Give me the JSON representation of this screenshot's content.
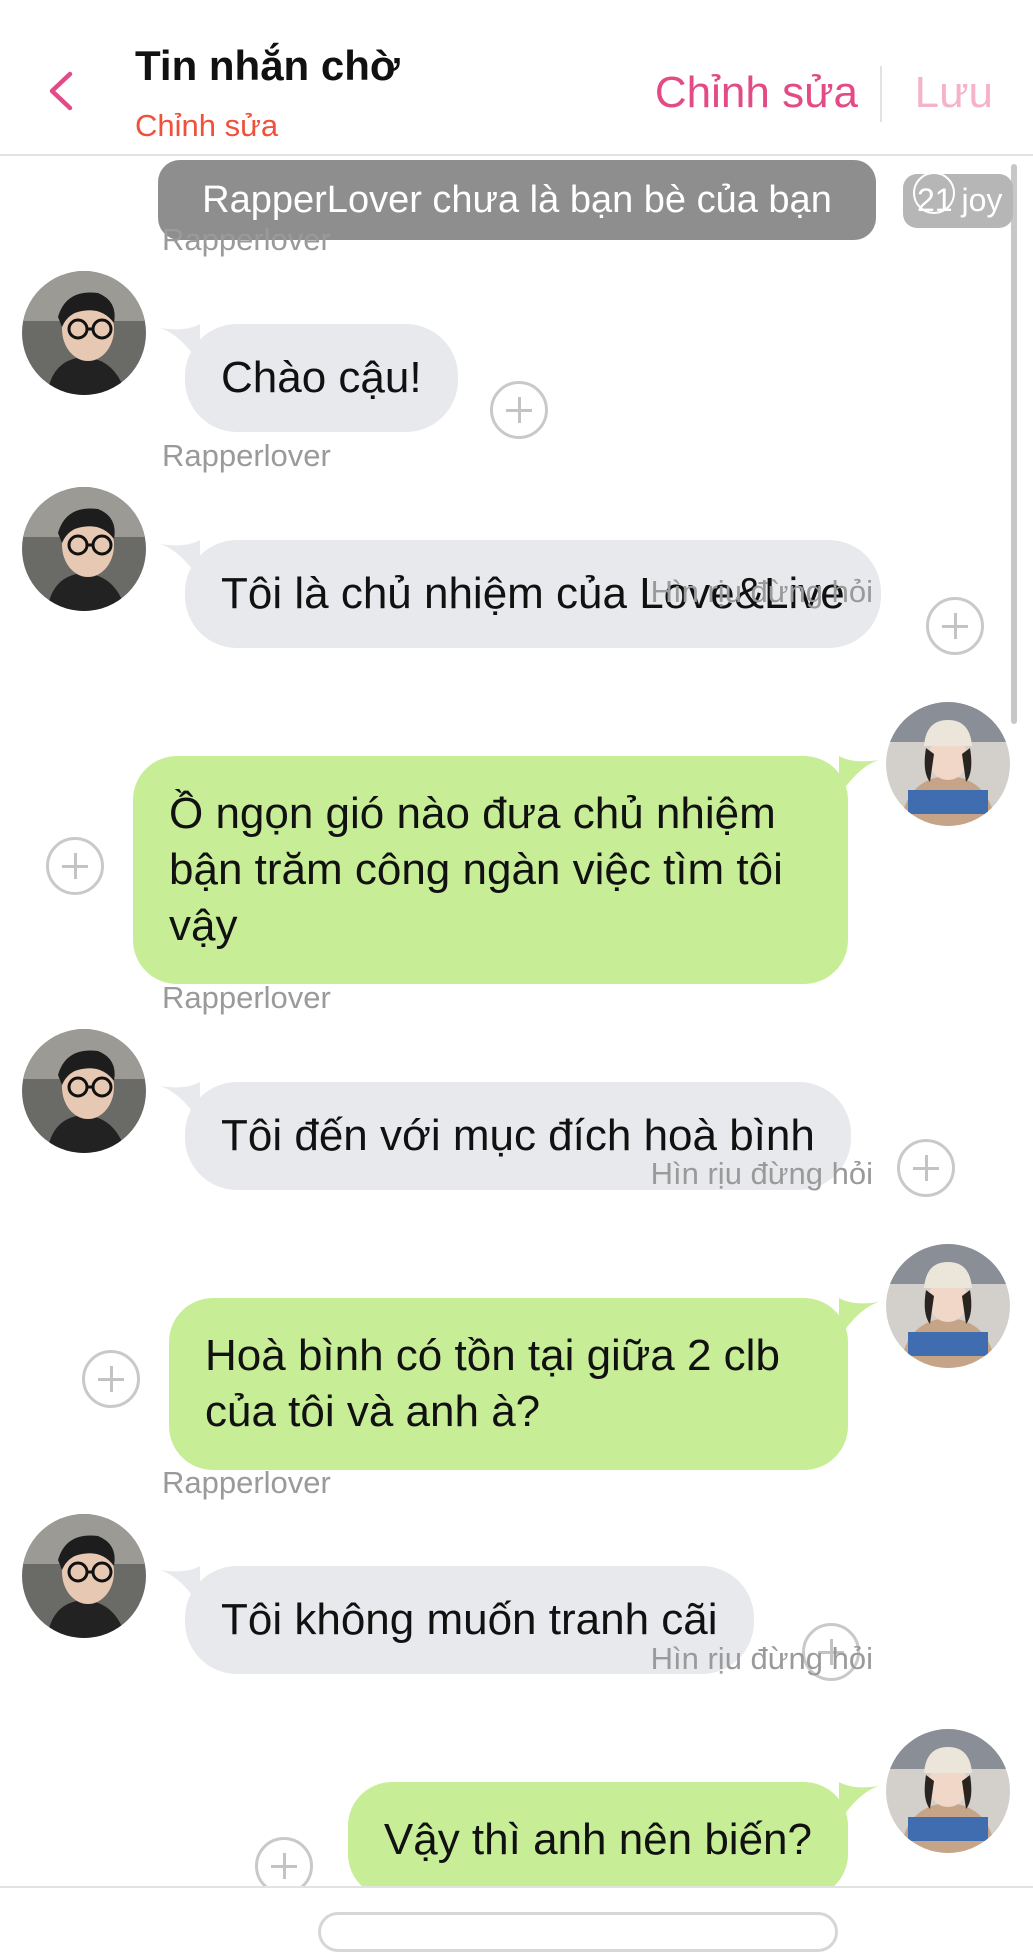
{
  "header": {
    "title": "Tin nhắn chờ",
    "subtitle": "Chỉnh sửa",
    "edit_label": "Chỉnh sửa",
    "save_label": "Lưu"
  },
  "notice": {
    "text": "RapperLover chưa là bạn bè của bạn",
    "badge": "21 joy"
  },
  "messages": [
    {
      "sender": "Rapperlover",
      "text": "Chào cậu!",
      "direction": "incoming"
    },
    {
      "sender": "Rapperlover",
      "text": "Tôi là chủ nhiệm của Love&Live",
      "direction": "incoming"
    },
    {
      "sender": "Hìn rịu đừng hỏi",
      "text": "Ồ ngọn gió nào đưa chủ nhiệm bận trăm công ngàn việc tìm tôi vậy",
      "direction": "outgoing"
    },
    {
      "sender": "Rapperlover",
      "text": "Tôi đến với mục đích hoà bình",
      "direction": "incoming"
    },
    {
      "sender": "Hìn rịu đừng hỏi",
      "text": "Hoà bình có tồn tại giữa 2 clb của tôi và anh à?",
      "direction": "outgoing"
    },
    {
      "sender": "Rapperlover",
      "text": "Tôi không muốn tranh cãi",
      "direction": "incoming"
    },
    {
      "sender": "Hìn rịu đừng hỏi",
      "text": "Vậy thì anh nên biến?",
      "direction": "outgoing"
    }
  ],
  "colors": {
    "accent": "#e34b86",
    "subtitle": "#f0513a",
    "incoming_bubble": "#e8e9ec",
    "outgoing_bubble": "#c8ed97",
    "notice_bg": "#8e8e8e"
  }
}
